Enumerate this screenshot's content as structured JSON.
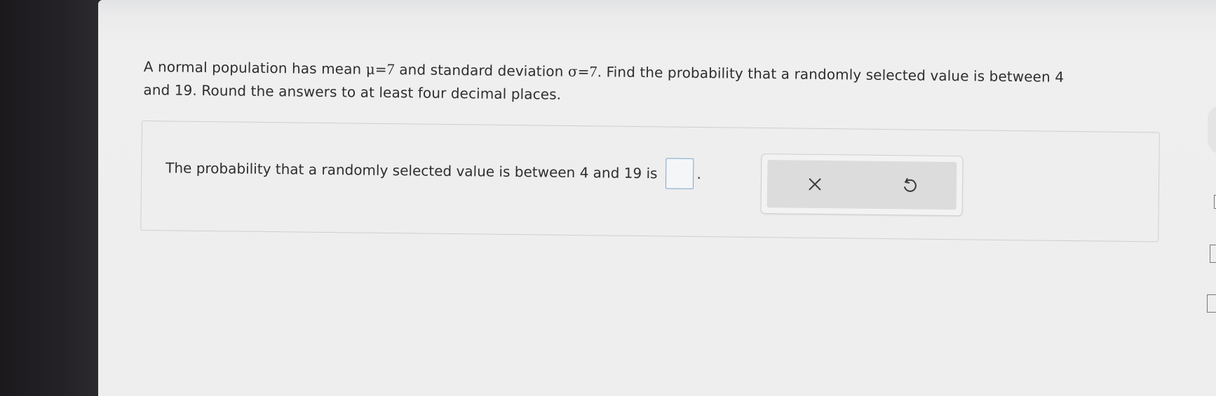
{
  "question": {
    "text_part1": "A normal population has mean ",
    "mu_symbol": "μ",
    "eq1": "=",
    "mu_value": "7",
    "text_part2": " and standard deviation ",
    "sigma_symbol": "σ",
    "eq2": "=",
    "sigma_value": "7",
    "text_part3": ". Find the probability that a randomly selected value is between 4",
    "text_part4": "and 19. Round the answers to at least four decimal places."
  },
  "answer": {
    "prompt": "The probability that a randomly selected value is between 4 and 19 is",
    "value": "",
    "period": "."
  },
  "tools": {
    "clear_icon": "close-icon",
    "undo_icon": "undo-icon"
  },
  "colors": {
    "answer_box_border": "#7fa6c9",
    "tools_background": "#dcdcdc"
  }
}
